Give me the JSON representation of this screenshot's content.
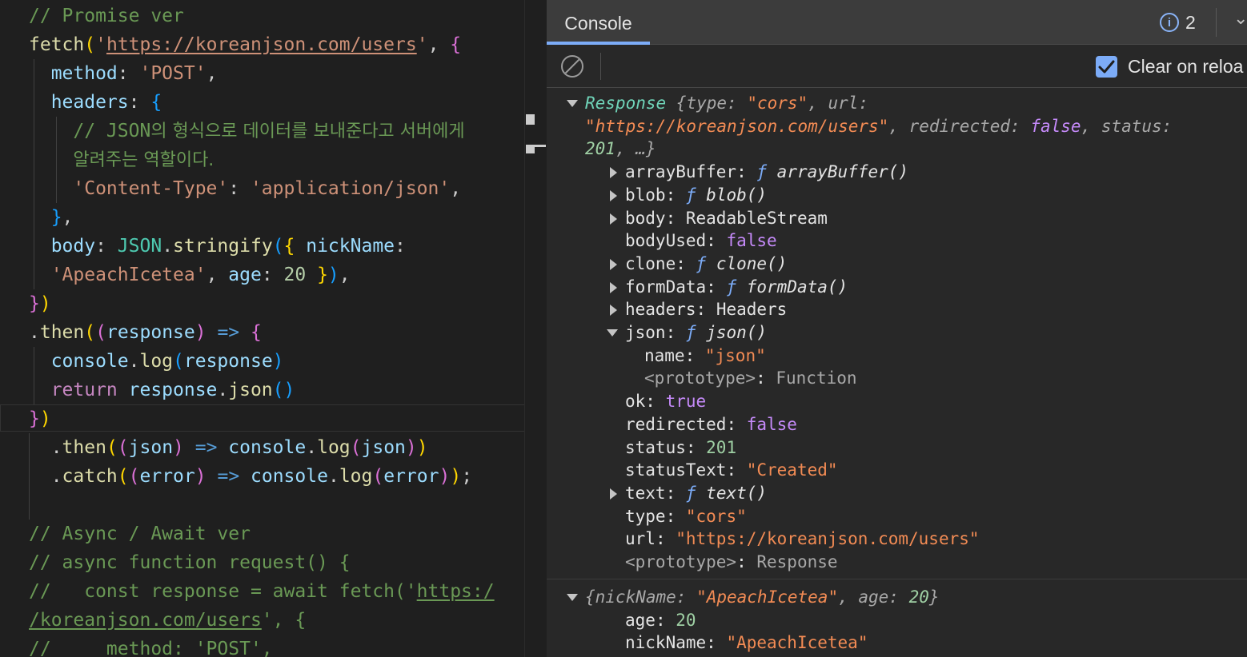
{
  "editor": {
    "lines": [
      [
        {
          "c": "cm",
          "t": "// Promise ver"
        }
      ],
      [
        {
          "c": "fn",
          "t": "fetch"
        },
        {
          "c": "br1",
          "t": "("
        },
        {
          "c": "st",
          "t": "'"
        },
        {
          "c": "st u",
          "t": "https://koreanjson.com/users"
        },
        {
          "c": "st",
          "t": "'"
        },
        {
          "c": "pu",
          "t": ", "
        },
        {
          "c": "br2",
          "t": "{"
        }
      ],
      [
        {
          "c": "pr",
          "t": "  method"
        },
        {
          "c": "pu",
          "t": ": "
        },
        {
          "c": "st",
          "t": "'POST'"
        },
        {
          "c": "pu",
          "t": ","
        }
      ],
      [
        {
          "c": "pr",
          "t": "  headers"
        },
        {
          "c": "pu",
          "t": ": "
        },
        {
          "c": "br3",
          "t": "{"
        }
      ],
      [
        {
          "c": "cm",
          "t": "    // JSON"
        },
        {
          "c": "cm ko",
          "t": "의 형식으로 데이터를 보내준다고 서버에게"
        }
      ],
      [
        {
          "c": "cm",
          "t": "    "
        },
        {
          "c": "cm ko",
          "t": "알려주는 역할이다."
        }
      ],
      [
        {
          "c": "st",
          "t": "    'Content-Type'"
        },
        {
          "c": "pu",
          "t": ": "
        },
        {
          "c": "st",
          "t": "'application/json'"
        },
        {
          "c": "pu",
          "t": ","
        }
      ],
      [
        {
          "c": "br3",
          "t": "  }"
        },
        {
          "c": "pu",
          "t": ","
        }
      ],
      [
        {
          "c": "pr",
          "t": "  body"
        },
        {
          "c": "pu",
          "t": ": "
        },
        {
          "c": "ty",
          "t": "JSON"
        },
        {
          "c": "pu",
          "t": "."
        },
        {
          "c": "fn",
          "t": "stringify"
        },
        {
          "c": "br3",
          "t": "("
        },
        {
          "c": "br1",
          "t": "{"
        },
        {
          "c": "pr",
          "t": " nickName"
        },
        {
          "c": "pu",
          "t": ":"
        }
      ],
      [
        {
          "c": "st",
          "t": "  'ApeachIcetea'"
        },
        {
          "c": "pu",
          "t": ", "
        },
        {
          "c": "pr",
          "t": "age"
        },
        {
          "c": "pu",
          "t": ": "
        },
        {
          "c": "nu",
          "t": "20"
        },
        {
          "c": "br1",
          "t": " }"
        },
        {
          "c": "br3",
          "t": ")"
        },
        {
          "c": "pu",
          "t": ","
        }
      ],
      [
        {
          "c": "br2",
          "t": "}"
        },
        {
          "c": "br1",
          "t": ")"
        }
      ],
      [
        {
          "c": "pu",
          "t": "."
        },
        {
          "c": "fn",
          "t": "then"
        },
        {
          "c": "br1",
          "t": "("
        },
        {
          "c": "br2",
          "t": "("
        },
        {
          "c": "pr",
          "t": "response"
        },
        {
          "c": "br2",
          "t": ")"
        },
        {
          "c": "ar",
          "t": " => "
        },
        {
          "c": "br2",
          "t": "{"
        }
      ],
      [
        {
          "c": "pr",
          "t": "  console"
        },
        {
          "c": "pu",
          "t": "."
        },
        {
          "c": "fn",
          "t": "log"
        },
        {
          "c": "br3",
          "t": "("
        },
        {
          "c": "pr",
          "t": "response"
        },
        {
          "c": "br3",
          "t": ")"
        }
      ],
      [
        {
          "c": "kw",
          "t": "  return "
        },
        {
          "c": "pr",
          "t": "response"
        },
        {
          "c": "pu",
          "t": "."
        },
        {
          "c": "fn",
          "t": "json"
        },
        {
          "c": "br3",
          "t": "()"
        }
      ],
      [
        {
          "c": "br2",
          "t": "}"
        },
        {
          "c": "br1",
          "t": ")"
        }
      ],
      [
        {
          "c": "pu",
          "t": "  ."
        },
        {
          "c": "fn",
          "t": "then"
        },
        {
          "c": "br1",
          "t": "("
        },
        {
          "c": "br2",
          "t": "("
        },
        {
          "c": "pr",
          "t": "json"
        },
        {
          "c": "br2",
          "t": ")"
        },
        {
          "c": "ar",
          "t": " => "
        },
        {
          "c": "pr",
          "t": "console"
        },
        {
          "c": "pu",
          "t": "."
        },
        {
          "c": "fn",
          "t": "log"
        },
        {
          "c": "br2",
          "t": "("
        },
        {
          "c": "pr",
          "t": "json"
        },
        {
          "c": "br2",
          "t": ")"
        },
        {
          "c": "br1",
          "t": ")"
        }
      ],
      [
        {
          "c": "pu",
          "t": "  ."
        },
        {
          "c": "fn",
          "t": "catch"
        },
        {
          "c": "br1",
          "t": "("
        },
        {
          "c": "br2",
          "t": "("
        },
        {
          "c": "pr",
          "t": "error"
        },
        {
          "c": "br2",
          "t": ")"
        },
        {
          "c": "ar",
          "t": " => "
        },
        {
          "c": "pr",
          "t": "console"
        },
        {
          "c": "pu",
          "t": "."
        },
        {
          "c": "fn",
          "t": "log"
        },
        {
          "c": "br2",
          "t": "("
        },
        {
          "c": "pr",
          "t": "error"
        },
        {
          "c": "br2",
          "t": ")"
        },
        {
          "c": "br1",
          "t": ")"
        },
        {
          "c": "pu",
          "t": ";"
        }
      ],
      [],
      [
        {
          "c": "cm",
          "t": "// Async / Await ver"
        }
      ],
      [
        {
          "c": "cm",
          "t": "// async function request() {"
        }
      ],
      [
        {
          "c": "cm",
          "t": "//   const response = await fetch('"
        },
        {
          "c": "cm u",
          "t": "https:/"
        }
      ],
      [
        {
          "c": "cm u",
          "t": "/koreanjson.com/users"
        },
        {
          "c": "cm",
          "t": "', {"
        }
      ],
      [
        {
          "c": "cm",
          "t": "//     method: 'POST',"
        }
      ]
    ]
  },
  "devtools": {
    "tab_label": "Console",
    "issue_count": "2",
    "clear_on_reload_label": "Clear on reloa",
    "messages": [
      {
        "lines": [
          {
            "indent": 0,
            "tri": "down",
            "parts": [
              {
                "c": "v-cls it",
                "t": "Response "
              },
              {
                "c": "k-grey it",
                "t": "{type: "
              },
              {
                "c": "v-str it",
                "t": "\"cors\""
              },
              {
                "c": "k-grey it",
                "t": ", url:"
              }
            ]
          },
          {
            "indent": 0,
            "tri": "",
            "parts": [
              {
                "c": "v-str it",
                "t": "\"https://koreanjson.com/users\""
              },
              {
                "c": "k-grey it",
                "t": ", redirected: "
              },
              {
                "c": "v-kw it",
                "t": "false"
              },
              {
                "c": "k-grey it",
                "t": ", status:"
              }
            ]
          },
          {
            "indent": 0,
            "tri": "",
            "parts": [
              {
                "c": "v-num it",
                "t": "201"
              },
              {
                "c": "k-grey it",
                "t": ", …}"
              }
            ]
          },
          {
            "indent": 1,
            "tri": "right",
            "parts": [
              {
                "c": "k-key",
                "t": "arrayBuffer"
              },
              {
                "c": "v-plain",
                "t": ": "
              },
              {
                "c": "v-fn it",
                "t": "ƒ "
              },
              {
                "c": "v-plain it",
                "t": "arrayBuffer()"
              }
            ]
          },
          {
            "indent": 1,
            "tri": "right",
            "parts": [
              {
                "c": "k-key",
                "t": "blob"
              },
              {
                "c": "v-plain",
                "t": ": "
              },
              {
                "c": "v-fn it",
                "t": "ƒ "
              },
              {
                "c": "v-plain it",
                "t": "blob()"
              }
            ]
          },
          {
            "indent": 1,
            "tri": "right",
            "parts": [
              {
                "c": "k-key",
                "t": "body"
              },
              {
                "c": "v-plain",
                "t": ": "
              },
              {
                "c": "v-plain",
                "t": "ReadableStream"
              }
            ]
          },
          {
            "indent": 1,
            "tri": "",
            "parts": [
              {
                "c": "k-key",
                "t": "bodyUsed"
              },
              {
                "c": "v-plain",
                "t": ": "
              },
              {
                "c": "v-kw",
                "t": "false"
              }
            ]
          },
          {
            "indent": 1,
            "tri": "right",
            "parts": [
              {
                "c": "k-key",
                "t": "clone"
              },
              {
                "c": "v-plain",
                "t": ": "
              },
              {
                "c": "v-fn it",
                "t": "ƒ "
              },
              {
                "c": "v-plain it",
                "t": "clone()"
              }
            ]
          },
          {
            "indent": 1,
            "tri": "right",
            "parts": [
              {
                "c": "k-key",
                "t": "formData"
              },
              {
                "c": "v-plain",
                "t": ": "
              },
              {
                "c": "v-fn it",
                "t": "ƒ "
              },
              {
                "c": "v-plain it",
                "t": "formData()"
              }
            ]
          },
          {
            "indent": 1,
            "tri": "right",
            "parts": [
              {
                "c": "k-key",
                "t": "headers"
              },
              {
                "c": "v-plain",
                "t": ": "
              },
              {
                "c": "v-plain",
                "t": "Headers"
              }
            ]
          },
          {
            "indent": 1,
            "tri": "down",
            "parts": [
              {
                "c": "k-key",
                "t": "json"
              },
              {
                "c": "v-plain",
                "t": ": "
              },
              {
                "c": "v-fn it",
                "t": "ƒ "
              },
              {
                "c": "v-plain it",
                "t": "json()"
              }
            ]
          },
          {
            "indent": 2,
            "tri": "",
            "parts": [
              {
                "c": "k-key",
                "t": "name"
              },
              {
                "c": "v-plain",
                "t": ": "
              },
              {
                "c": "v-str",
                "t": "\"json\""
              }
            ]
          },
          {
            "indent": 2,
            "tri": "",
            "parts": [
              {
                "c": "k-grey",
                "t": "<prototype>"
              },
              {
                "c": "v-plain",
                "t": ": "
              },
              {
                "c": "k-grey",
                "t": "Function"
              }
            ]
          },
          {
            "indent": 1,
            "tri": "",
            "parts": [
              {
                "c": "k-key",
                "t": "ok"
              },
              {
                "c": "v-plain",
                "t": ": "
              },
              {
                "c": "v-kw",
                "t": "true"
              }
            ]
          },
          {
            "indent": 1,
            "tri": "",
            "parts": [
              {
                "c": "k-key",
                "t": "redirected"
              },
              {
                "c": "v-plain",
                "t": ": "
              },
              {
                "c": "v-kw",
                "t": "false"
              }
            ]
          },
          {
            "indent": 1,
            "tri": "",
            "parts": [
              {
                "c": "k-key",
                "t": "status"
              },
              {
                "c": "v-plain",
                "t": ": "
              },
              {
                "c": "v-num",
                "t": "201"
              }
            ]
          },
          {
            "indent": 1,
            "tri": "",
            "parts": [
              {
                "c": "k-key",
                "t": "statusText"
              },
              {
                "c": "v-plain",
                "t": ": "
              },
              {
                "c": "v-str",
                "t": "\"Created\""
              }
            ]
          },
          {
            "indent": 1,
            "tri": "right",
            "parts": [
              {
                "c": "k-key",
                "t": "text"
              },
              {
                "c": "v-plain",
                "t": ": "
              },
              {
                "c": "v-fn it",
                "t": "ƒ "
              },
              {
                "c": "v-plain it",
                "t": "text()"
              }
            ]
          },
          {
            "indent": 1,
            "tri": "",
            "parts": [
              {
                "c": "k-key",
                "t": "type"
              },
              {
                "c": "v-plain",
                "t": ": "
              },
              {
                "c": "v-str",
                "t": "\"cors\""
              }
            ]
          },
          {
            "indent": 1,
            "tri": "",
            "parts": [
              {
                "c": "k-key",
                "t": "url"
              },
              {
                "c": "v-plain",
                "t": ": "
              },
              {
                "c": "v-str",
                "t": "\"https://koreanjson.com/users\""
              }
            ]
          },
          {
            "indent": 1,
            "tri": "",
            "parts": [
              {
                "c": "k-grey",
                "t": "<prototype>"
              },
              {
                "c": "v-plain",
                "t": ": "
              },
              {
                "c": "k-grey",
                "t": "Response"
              }
            ]
          }
        ]
      },
      {
        "lines": [
          {
            "indent": 0,
            "tri": "down",
            "parts": [
              {
                "c": "k-grey it",
                "t": "{nickName: "
              },
              {
                "c": "v-str it",
                "t": "\"ApeachIcetea\""
              },
              {
                "c": "k-grey it",
                "t": ", age: "
              },
              {
                "c": "v-num it",
                "t": "20"
              },
              {
                "c": "k-grey it",
                "t": "}"
              }
            ]
          },
          {
            "indent": 1,
            "tri": "",
            "parts": [
              {
                "c": "k-key",
                "t": "age"
              },
              {
                "c": "v-plain",
                "t": ": "
              },
              {
                "c": "v-num",
                "t": "20"
              }
            ]
          },
          {
            "indent": 1,
            "tri": "",
            "parts": [
              {
                "c": "k-key",
                "t": "nickName"
              },
              {
                "c": "v-plain",
                "t": ": "
              },
              {
                "c": "v-str",
                "t": "\"ApeachIcetea\""
              }
            ]
          }
        ]
      }
    ]
  },
  "icons": {
    "clear": "clear-console-icon",
    "info": "info-icon",
    "checkbox": "checkbox-checked-icon",
    "chevron": "chevron-down-icon"
  }
}
